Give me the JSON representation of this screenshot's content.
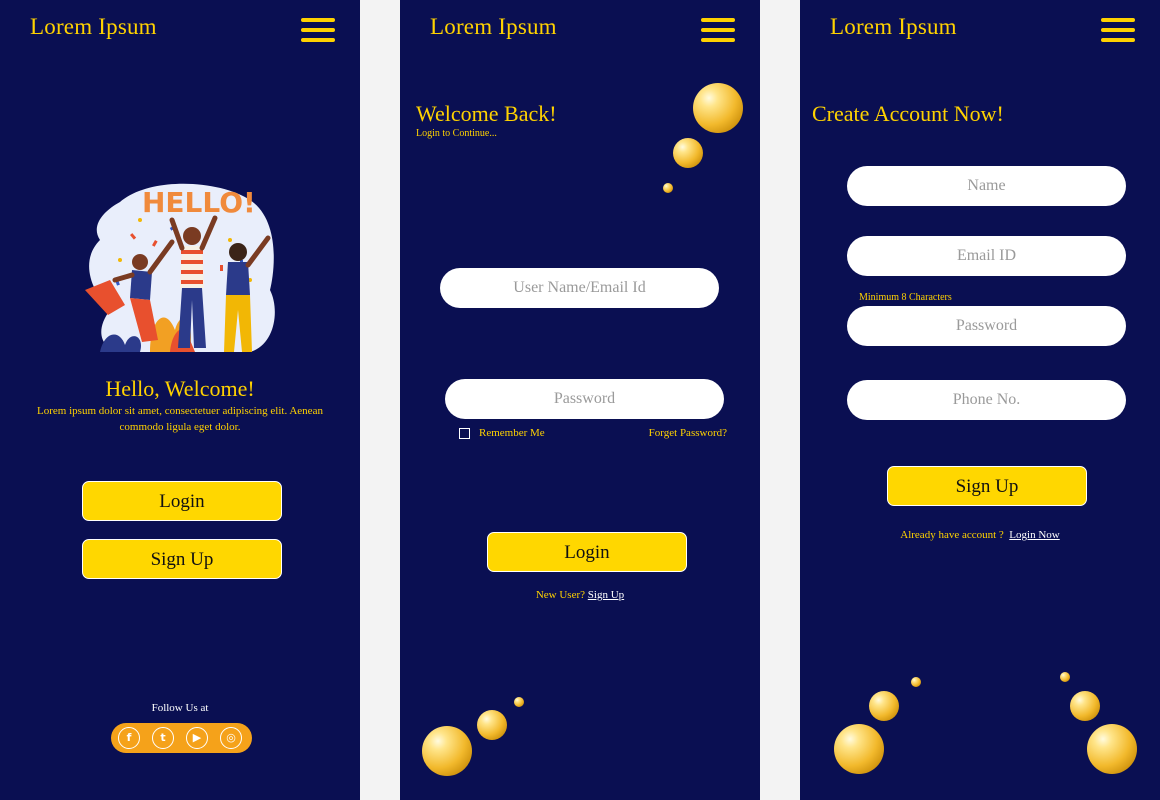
{
  "brand": "Lorem Ipsum",
  "colors": {
    "background": "#0a0f52",
    "accent": "#ffd200",
    "button": "#ffd700",
    "social_bar": "#f5a21a"
  },
  "screen1": {
    "illustration_text": "HELLO!",
    "title": "Hello, Welcome!",
    "description": "Lorem ipsum dolor sit amet, consectetuer adipiscing elit. Aenean commodo ligula eget dolor.",
    "login_label": "Login",
    "signup_label": "Sign Up",
    "follow_label": "Follow Us at",
    "social": [
      {
        "icon": "facebook-icon",
        "glyph": "f"
      },
      {
        "icon": "twitter-icon",
        "glyph": "t"
      },
      {
        "icon": "youtube-icon",
        "glyph": "▶"
      },
      {
        "icon": "instagram-icon",
        "glyph": "◎"
      }
    ]
  },
  "screen2": {
    "title": "Welcome Back!",
    "subtitle": "Login to Continue...",
    "username_placeholder": "User Name/Email Id",
    "password_placeholder": "Password",
    "remember_label": "Remember Me",
    "forgot_label": "Forget Password?",
    "login_label": "Login",
    "new_user_label": "New User?",
    "signup_link": "Sign Up"
  },
  "screen3": {
    "title": "Create Account Now!",
    "name_placeholder": "Name",
    "email_placeholder": "Email ID",
    "password_hint": "Minimum 8 Characters",
    "password_placeholder": "Password",
    "phone_placeholder": "Phone No.",
    "signup_label": "Sign Up",
    "already_label": "Already have account ?",
    "login_link": "Login Now"
  }
}
